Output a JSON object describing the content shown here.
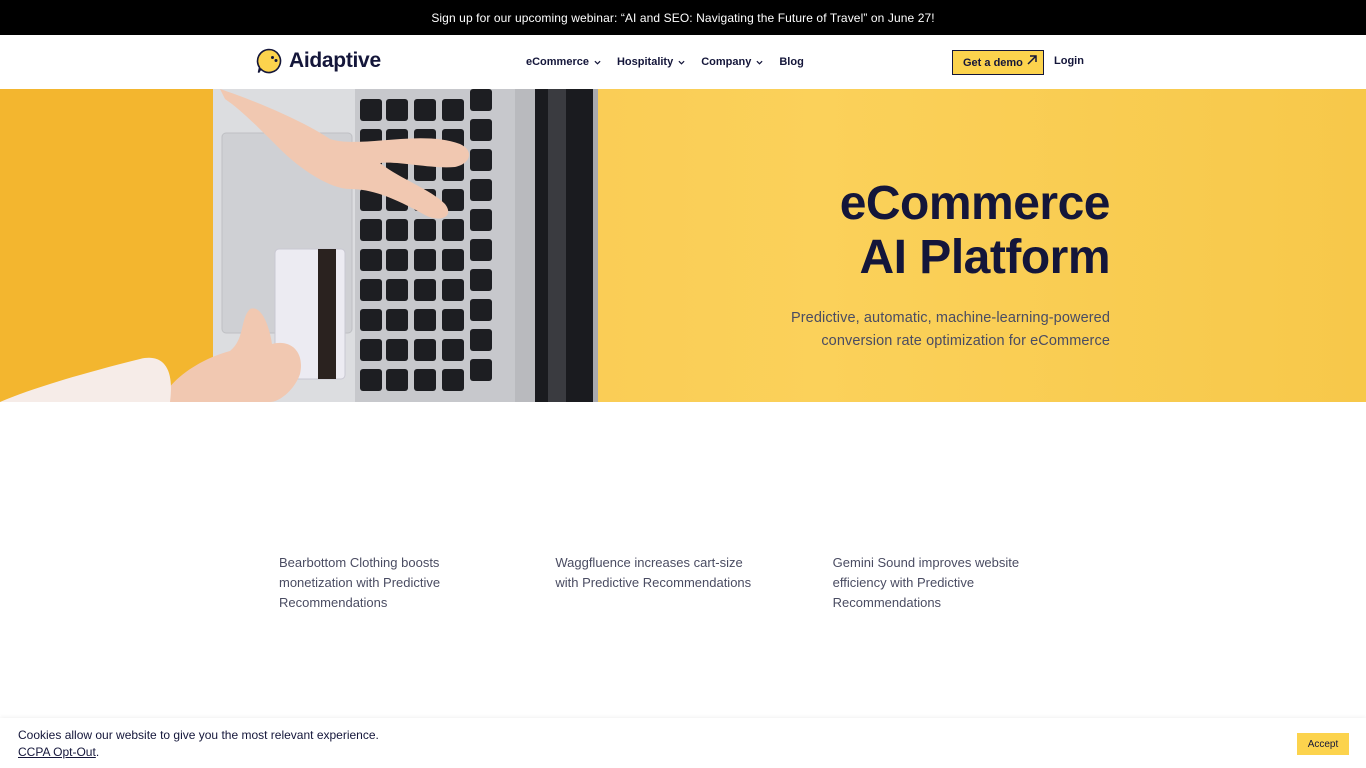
{
  "announcement": {
    "text": "Sign up for our upcoming webinar: “AI and SEO: Navigating the Future of Travel” on June 27!"
  },
  "header": {
    "logo_text": "Aidaptive",
    "logo_icon": "chat-bubble-face-icon",
    "nav": [
      {
        "label": "eCommerce",
        "has_dropdown": true
      },
      {
        "label": "Hospitality",
        "has_dropdown": true
      },
      {
        "label": "Company",
        "has_dropdown": true
      },
      {
        "label": "Blog",
        "has_dropdown": false
      }
    ],
    "demo_button": "Get a demo",
    "login": "Login"
  },
  "hero": {
    "title_line1": "eCommerce",
    "title_line2": "AI Platform",
    "subtitle_line1": "Predictive, automatic, machine-learning-powered",
    "subtitle_line2": "conversion rate optimization for eCommerce"
  },
  "cases": [
    {
      "text": "Bearbottom Clothing boosts monetization with Predictive Recommendations"
    },
    {
      "text": "Waggfluence increases cart-size with Predictive Recommendations"
    },
    {
      "text": "Gemini Sound improves website efficiency with Predictive Recommendations"
    }
  ],
  "cookie": {
    "text": "Cookies allow our website to give you the most relevant experience.",
    "link": "CCPA Opt-Out",
    "link_suffix": ".",
    "accept": "Accept"
  },
  "colors": {
    "accent": "#fcd34d",
    "hero_bg": "#fbcd4a",
    "navy": "#14163a",
    "text_muted": "#4a4c62"
  }
}
